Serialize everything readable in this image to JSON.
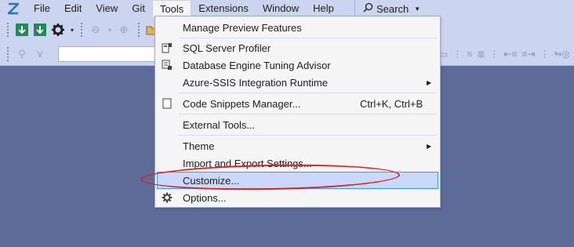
{
  "menubar": {
    "items": [
      "File",
      "Edit",
      "View",
      "Git",
      "Tools",
      "Extensions",
      "Window",
      "Help"
    ],
    "active": "Tools",
    "search_label": "Search"
  },
  "tools_menu": {
    "manage_preview": "Manage Preview Features",
    "sql_profiler": "SQL Server Profiler",
    "tuning_advisor": "Database Engine Tuning Advisor",
    "ssis_runtime": "Azure-SSIS Integration Runtime",
    "snippets": "Code Snippets Manager...",
    "snippets_shortcut": "Ctrl+K, Ctrl+B",
    "external_tools": "External Tools...",
    "theme": "Theme",
    "import_export": "Import and Export Settings...",
    "customize": "Customize...",
    "options": "Options..."
  },
  "colors": {
    "workspace": "#5d6b99",
    "menubar": "#ccd5f0",
    "highlight": "#c9d8fb",
    "annotation": "#e02020"
  }
}
